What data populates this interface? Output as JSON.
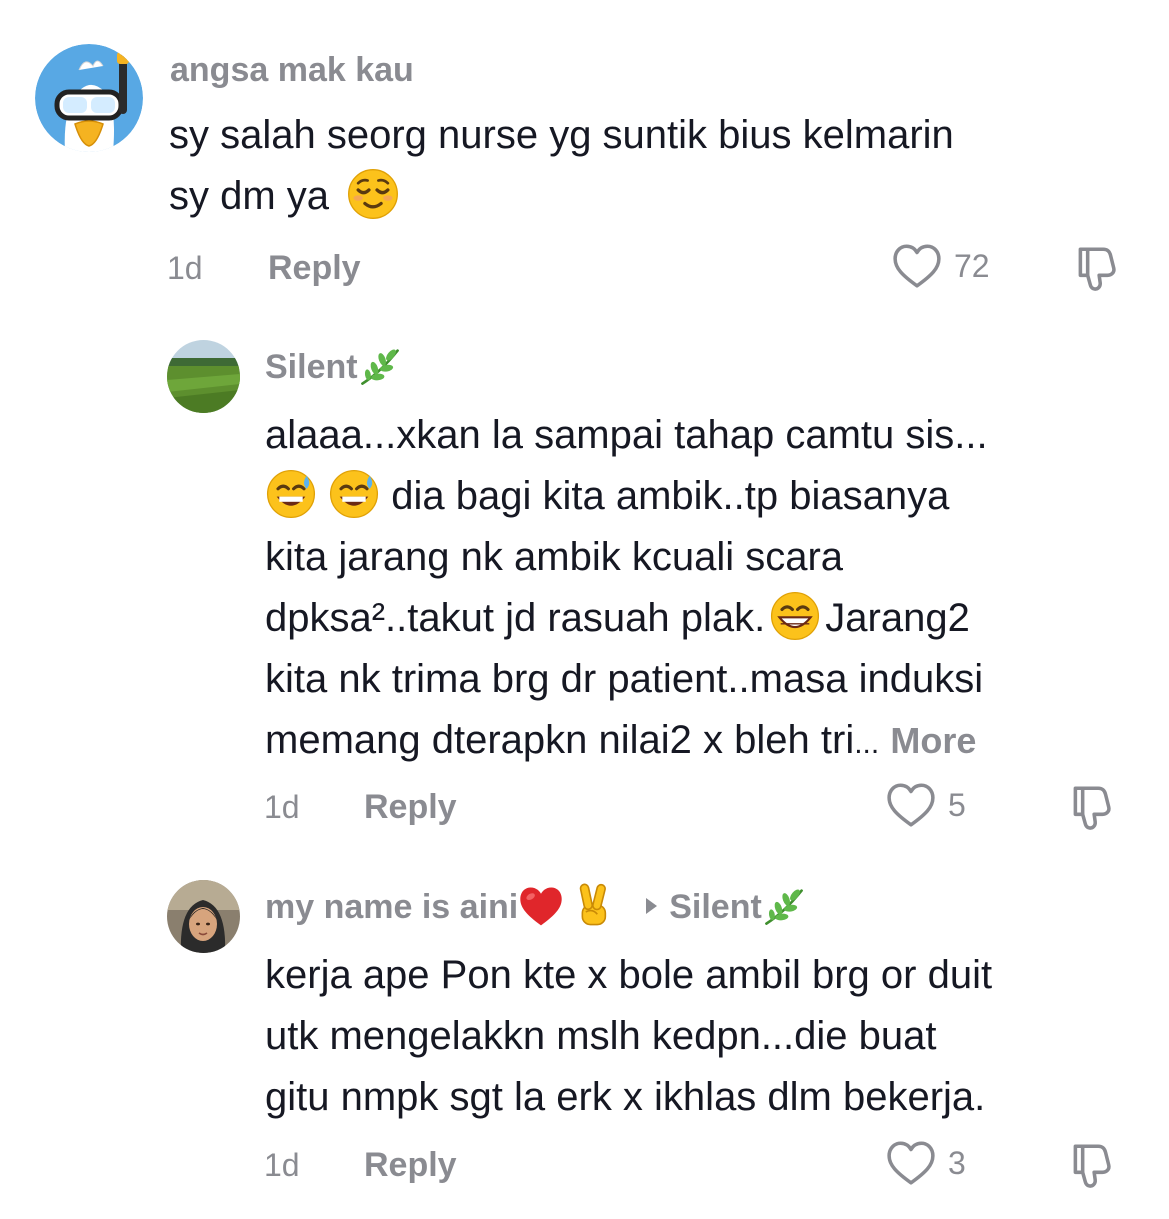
{
  "comments": [
    {
      "username": "angsa mak kau",
      "text_lines": [
        "sy salah seorg nurse yg suntik bius kelmarin",
        "sy dm ya"
      ],
      "emoji": "relieved-face",
      "time": "1d",
      "reply_label": "Reply",
      "likes": "72"
    },
    {
      "username": "Silent",
      "username_emoji": "herb",
      "line1": "alaaa...xkan la sampai tahap camtu sis...",
      "line2_text": " dia bagi kita ambik..tp biasanya",
      "line3": "kita jarang nk ambik kcuali scara",
      "line4_a": "dpksa²..takut jd rasuah plak.",
      "line4_b": "Jarang2",
      "line5": "kita nk trima brg dr patient..masa induksi",
      "line6": "memang dterapkn nilai2 x bleh tri",
      "ellipsis": "...",
      "more_label": "More",
      "time": "1d",
      "reply_label": "Reply",
      "likes": "5"
    },
    {
      "username": "my name is aini",
      "reply_to": "Silent",
      "text_lines": [
        "kerja ape Pon kte x bole ambil brg or duit",
        "utk mengelakkn mslh kedpn...die buat",
        "gitu nmpk sgt la erk x ikhlas dlm bekerja."
      ],
      "time": "1d",
      "reply_label": "Reply",
      "likes": "3"
    }
  ],
  "colors": {
    "muted": "#8a8b91",
    "text": "#161823",
    "heart_red": "#e0262b"
  },
  "icons": [
    "heart-outline-icon",
    "dislike-icon",
    "relieved-face-emoji",
    "sweat-smile-emoji",
    "grin-emoji",
    "red-heart-emoji",
    "victory-hand-emoji",
    "herb-emoji",
    "reply-arrow-icon"
  ]
}
